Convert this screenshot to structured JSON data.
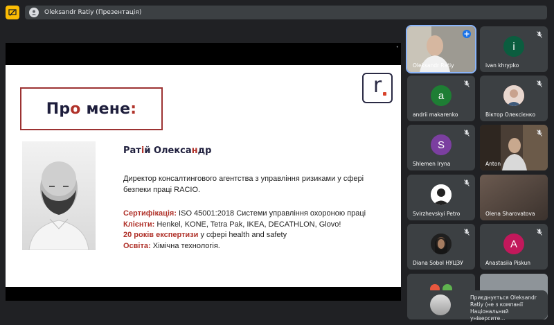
{
  "presentation": {
    "chip_text": "Oleksandr Ratiy (Презентація)"
  },
  "slide": {
    "title_pre": "Пр",
    "title_o": "о",
    "title_post": " мене",
    "title_colon": ":",
    "logo_letter": "r",
    "name_pre": "Рат",
    "name_i": "і",
    "name_mid": "й Олекса",
    "name_n": "н",
    "name_post": "др",
    "description": "Директор консалтингового агентства з управління ризиками у сфері безпеки праці RACIO.",
    "facts": [
      {
        "key": "Сертифікація:",
        "value": " ISO 45001:2018 Системи управління охороною праці"
      },
      {
        "key": "Клієнти:",
        "value": " Henkel, KONE, Tetra Pak, IKEA, DECATHLON, Glovo!"
      },
      {
        "key": "20 років експертизи",
        "value": " у сфері health and safety"
      },
      {
        "key": "Освіта:",
        "value": " Хімічна технологія."
      }
    ]
  },
  "participants": [
    {
      "name": "Oleksandr Ratiy",
      "type": "video",
      "selected": true
    },
    {
      "name": "ivan khrypko",
      "type": "avatar",
      "initial": "i",
      "color": "#0b5d3f"
    },
    {
      "name": "andrii makarenko",
      "type": "avatar",
      "initial": "a",
      "color": "#1e7e34"
    },
    {
      "name": "Віктор Олексієнко",
      "type": "photo"
    },
    {
      "name": "Shlemen Iryna",
      "type": "avatar",
      "initial": "S",
      "color": "#7b3fa0"
    },
    {
      "name": "Anton",
      "type": "video"
    },
    {
      "name": "Svirzhevskyi Petro",
      "type": "photo"
    },
    {
      "name": "Olena Sharovatova",
      "type": "video"
    },
    {
      "name": "Diana Sobol НУЦЗУ",
      "type": "photo"
    },
    {
      "name": "Anastasiia Piskun",
      "type": "avatar",
      "initial": "A",
      "color": "#c2185b"
    }
  ],
  "toast": {
    "text": "Приєднується Oleksandr Ratiy (не з компанії Національний університе..."
  }
}
